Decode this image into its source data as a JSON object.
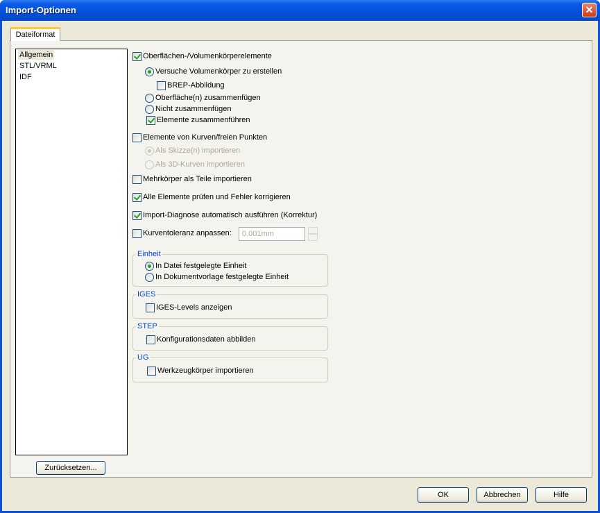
{
  "window": {
    "title": "Import-Optionen",
    "close_symbol": "✕"
  },
  "tab": {
    "label": "Dateiformat"
  },
  "sidebar": {
    "items": [
      {
        "label": "Allgemein"
      },
      {
        "label": "STL/VRML"
      },
      {
        "label": "IDF"
      }
    ]
  },
  "options": {
    "surfaces": "Oberflächen-/Volumenkörperelemente",
    "try_solids": "Versuche Volumenkörper zu erstellen",
    "brep": "BREP-Abbildung",
    "knit": "Oberfläche(n) zusammenfügen",
    "no_knit": "Nicht zusammenfügen",
    "merge": "Elemente zusammenführen",
    "curves": "Elemente von Kurven/freien Punkten",
    "as_sketch": "Als Skizze(n) importieren",
    "as_3d": "Als 3D-Kurven importieren",
    "multibody": "Mehrkörper als Teile importieren",
    "check": "Alle Elemente prüfen und Fehler korrigieren",
    "diagnose": "Import-Diagnose automatisch ausführen (Korrektur)",
    "tolerance": "Kurventoleranz anpassen:",
    "tolerance_value": "0.001mm"
  },
  "groups": {
    "unit": {
      "title": "Einheit",
      "file_unit": "In Datei festgelegte Einheit",
      "template_unit": "In Dokumentvorlage festgelegte Einheit"
    },
    "iges": {
      "title": "IGES",
      "levels": "IGES-Levels anzeigen"
    },
    "step": {
      "title": "STEP",
      "config": "Konfigurationsdaten abbilden"
    },
    "ug": {
      "title": "UG",
      "tool": "Werkzeugkörper importieren"
    }
  },
  "buttons": {
    "reset": "Zurücksetzen...",
    "ok": "OK",
    "cancel": "Abbrechen",
    "help": "Hilfe"
  }
}
